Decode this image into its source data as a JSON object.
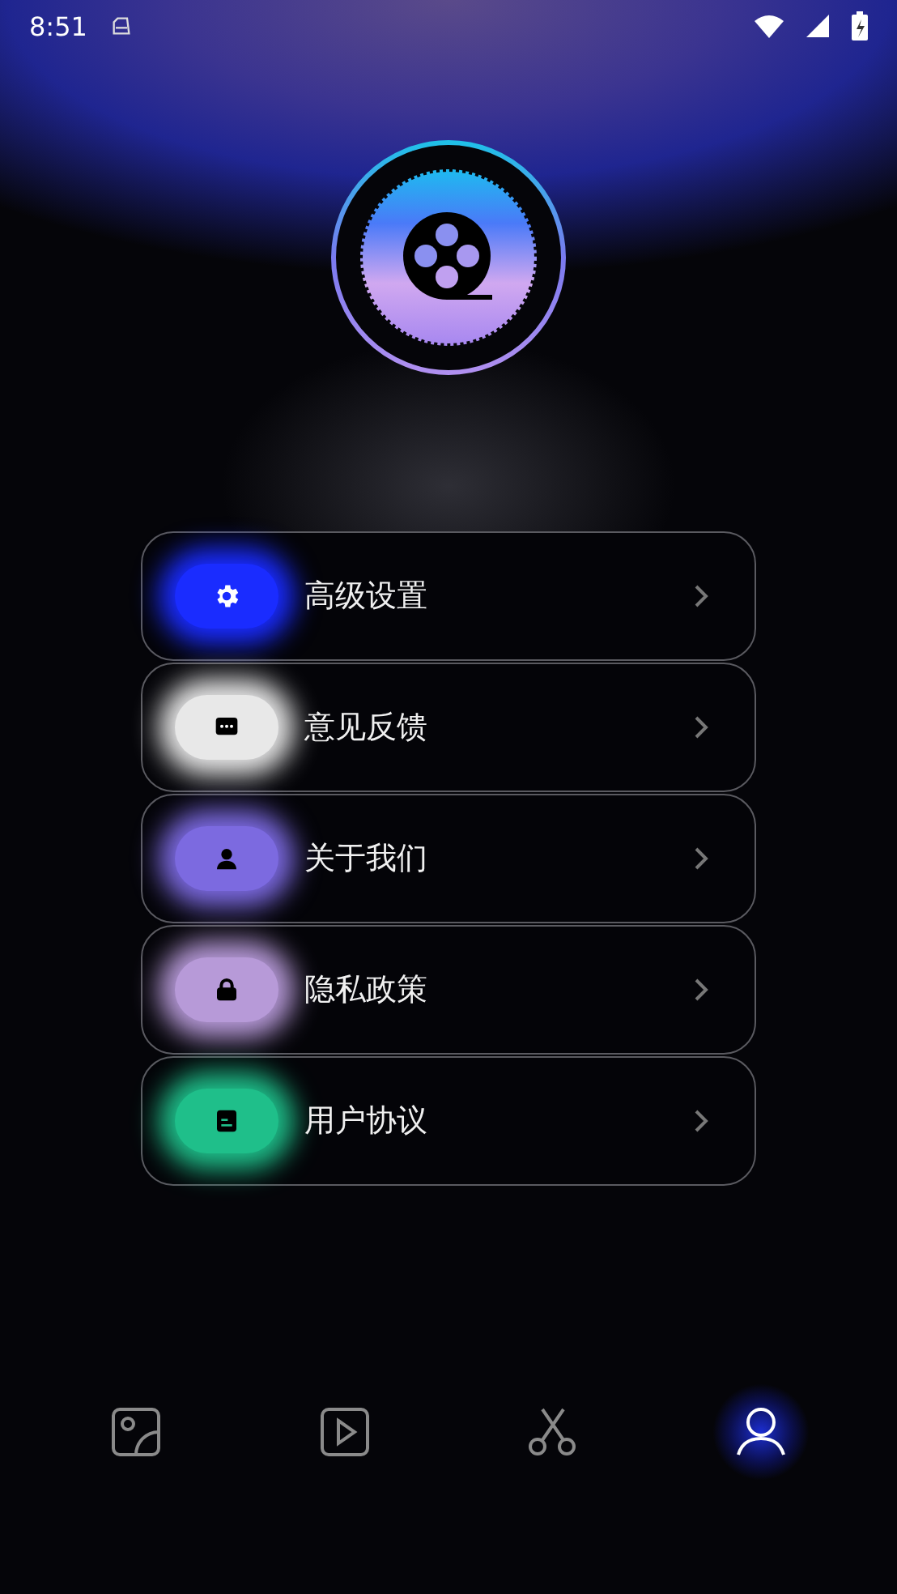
{
  "status_bar": {
    "time": "8:51"
  },
  "menu": [
    {
      "label": "高级设置",
      "kind": "settings",
      "color": "#1a2cff"
    },
    {
      "label": "意见反馈",
      "kind": "feedback",
      "color": "#e8e8e8"
    },
    {
      "label": "关于我们",
      "kind": "about",
      "color": "#7c6ae0"
    },
    {
      "label": "隐私政策",
      "kind": "privacy",
      "color": "#b79ad8"
    },
    {
      "label": "用户协议",
      "kind": "agreement",
      "color": "#1fbf8a"
    }
  ],
  "nav": [
    {
      "kind": "image",
      "selected": false
    },
    {
      "kind": "video",
      "selected": false
    },
    {
      "kind": "cut",
      "selected": false
    },
    {
      "kind": "profile",
      "selected": true
    }
  ]
}
